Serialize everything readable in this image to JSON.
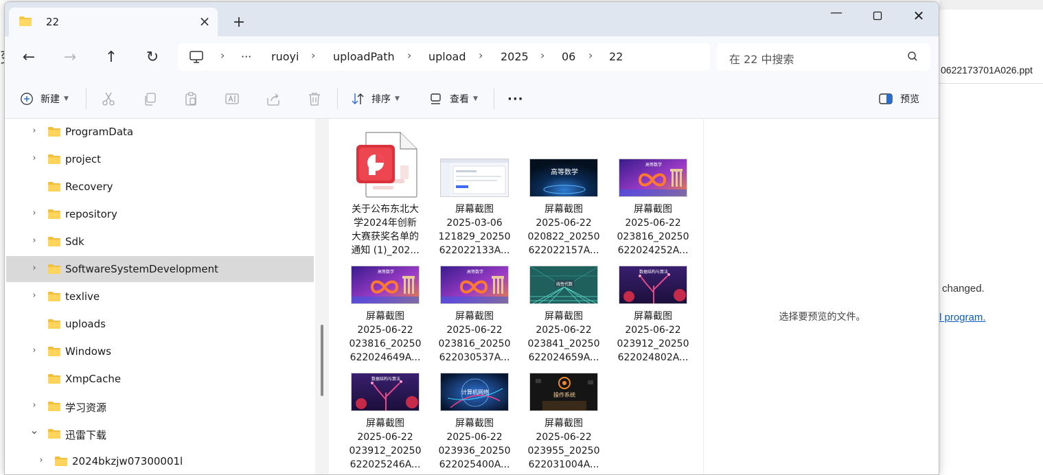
{
  "background_app": {
    "filename_fragment": "0622173701A026.ppt",
    "text_changed": "changed.",
    "link_text": "l program.",
    "left_char": "变"
  },
  "window": {
    "tab_title": "22",
    "controls": {
      "minimize": "—",
      "maximize": "□",
      "close": "✕"
    }
  },
  "nav": {
    "back": "←",
    "forward": "→",
    "up": "↑",
    "refresh": "↻",
    "breadcrumb": [
      "···",
      "ruoyi",
      "uploadPath",
      "upload",
      "2025",
      "06",
      "22"
    ],
    "search_placeholder": "在 22 中搜索"
  },
  "toolbar": {
    "new_label": "新建",
    "sort_label": "排序",
    "view_label": "查看",
    "more_label": "···",
    "preview_label": "预览"
  },
  "sidebar": {
    "items": [
      {
        "label": "ProgramData",
        "expandable": true
      },
      {
        "label": "project",
        "expandable": true
      },
      {
        "label": "Recovery",
        "expandable": false
      },
      {
        "label": "repository",
        "expandable": true
      },
      {
        "label": "Sdk",
        "expandable": true
      },
      {
        "label": "SoftwareSystemDevelopment",
        "expandable": true,
        "selected": true
      },
      {
        "label": "texlive",
        "expandable": true
      },
      {
        "label": "uploads",
        "expandable": false
      },
      {
        "label": "Windows",
        "expandable": true
      },
      {
        "label": "XmpCache",
        "expandable": false
      },
      {
        "label": "学习资源",
        "expandable": true
      },
      {
        "label": "迅雷下载",
        "expandable": true,
        "expanded": true
      },
      {
        "label": "2024bkzjw07300001l",
        "expandable": true,
        "child": true
      }
    ]
  },
  "files": [
    {
      "lines": [
        "关于公布东北大",
        "学2024年创新",
        "大赛获奖名单的",
        "通知 (1)_202..."
      ],
      "kind": "pptx"
    },
    {
      "lines": [
        "屏幕截图",
        "2025-03-06",
        "121829_20250",
        "622022133A..."
      ],
      "kind": "screenshot-web"
    },
    {
      "lines": [
        "屏幕截图",
        "2025-06-22",
        "020822_20250",
        "622022157A..."
      ],
      "kind": "math-dark",
      "thumb_text": "高等数学"
    },
    {
      "lines": [
        "屏幕截图",
        "2025-06-22",
        "023816_20250",
        "622024252A..."
      ],
      "kind": "math-infinity",
      "thumb_text": "高等数学"
    },
    {
      "lines": [
        "屏幕截图",
        "2025-06-22",
        "023816_20250",
        "622024649A..."
      ],
      "kind": "math-infinity",
      "thumb_text": "高等数学"
    },
    {
      "lines": [
        "屏幕截图",
        "2025-06-22",
        "023816_20250",
        "622030537A..."
      ],
      "kind": "math-infinity",
      "thumb_text": "高等数学"
    },
    {
      "lines": [
        "屏幕截图",
        "2025-06-22",
        "023841_20250",
        "622024659A..."
      ],
      "kind": "linear-algebra",
      "thumb_text": "线性代数"
    },
    {
      "lines": [
        "屏幕截图",
        "2025-06-22",
        "023912_20250",
        "622024802A..."
      ],
      "kind": "data-structure",
      "thumb_text": "数据结构与算法"
    },
    {
      "lines": [
        "屏幕截图",
        "2025-06-22",
        "023912_20250",
        "622025246A..."
      ],
      "kind": "data-structure",
      "thumb_text": "数据结构与算法"
    },
    {
      "lines": [
        "屏幕截图",
        "2025-06-22",
        "023936_20250",
        "622025400A..."
      ],
      "kind": "network",
      "thumb_text": "计算机网络"
    },
    {
      "lines": [
        "屏幕截图",
        "2025-06-22",
        "023955_20250",
        "622031004A..."
      ],
      "kind": "os",
      "thumb_text": "操作系统"
    }
  ],
  "preview": {
    "empty_message": "选择要预览的文件。"
  }
}
